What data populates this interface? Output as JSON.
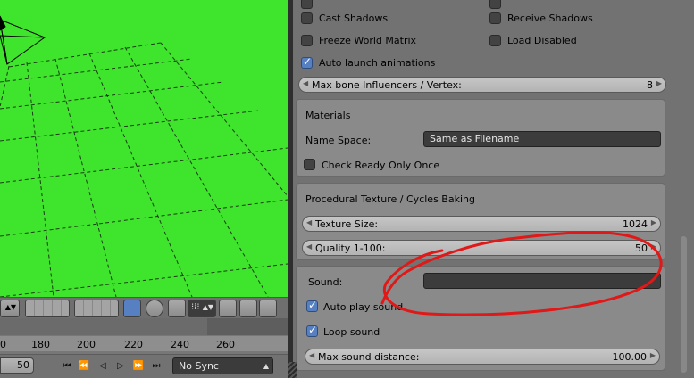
{
  "viewport": {
    "bg_color": "#3fe52d"
  },
  "timeline": {
    "ticks": [
      "0",
      "180",
      "200",
      "220",
      "240",
      "260"
    ],
    "current_frame": "50",
    "sync_value": "No Sync"
  },
  "props": {
    "cast_shadows": "Cast Shadows",
    "receive_shadows": "Receive Shadows",
    "freeze_world_matrix": "Freeze World Matrix",
    "load_disabled": "Load Disabled",
    "auto_launch": "Auto launch animations",
    "max_bone": {
      "label": "Max bone Influencers / Vertex:",
      "value": "8"
    },
    "materials": {
      "title": "Materials",
      "name_space_label": "Name Space:",
      "name_space_value": "Same as Filename",
      "check_ready": "Check Ready Only Once"
    },
    "procedural": {
      "title": "Procedural Texture / Cycles Baking",
      "texture_size": {
        "label": "Texture Size:",
        "value": "1024"
      },
      "quality": {
        "label": "Quality 1-100:",
        "value": "50"
      }
    },
    "sound": {
      "label": "Sound:",
      "value": "",
      "auto_play": "Auto play sound",
      "loop": "Loop sound",
      "max_distance": {
        "label": "Max sound distance:",
        "value": "100.00"
      }
    }
  },
  "annotation": {
    "color": "#e01818"
  }
}
